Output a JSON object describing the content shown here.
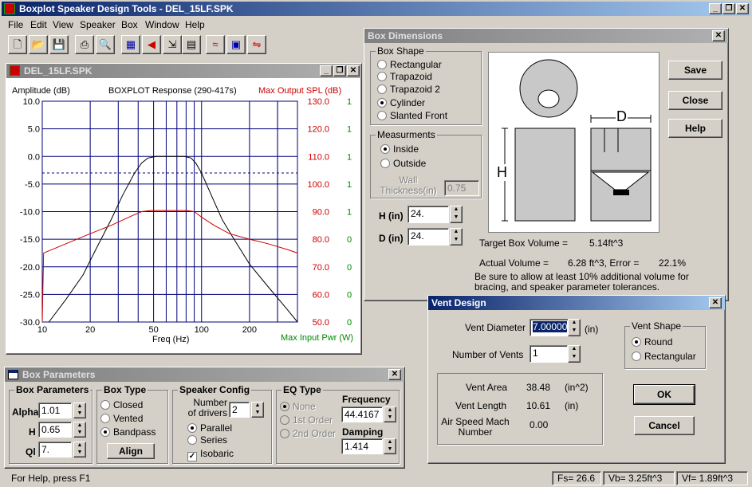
{
  "app": {
    "title": "Boxplot Speaker Design Tools - DEL_15LF.SPK"
  },
  "menu": [
    "File",
    "Edit",
    "View",
    "Speaker",
    "Box",
    "Window",
    "Help"
  ],
  "toolbar_icons": [
    "new-file-icon",
    "open-folder-icon",
    "save-disk-icon",
    "print-icon",
    "print-preview-icon",
    "speaker-params-icon",
    "speaker-cone-icon",
    "export-icon",
    "table-icon",
    "crossover-icon",
    "box-design-icon",
    "filter-icon"
  ],
  "graph": {
    "title": "DEL_15LF.SPK",
    "left_label": "Amplitude (dB)",
    "center_label": "BOXPLOT Response (290-417s)",
    "right_label": "Max Output SPL (dB)",
    "xlabel": "Freq (Hz)",
    "bottom_right_label": "Max Input Pwr (W)"
  },
  "chart_data": {
    "type": "line",
    "title": "BOXPLOT Response (290-417s)",
    "xlabel": "Freq (Hz)",
    "ylabel": "Amplitude (dB)",
    "xscale": "log",
    "xlim": [
      10,
      400
    ],
    "ylim": [
      -30,
      10
    ],
    "grid": true,
    "x_ticks": [
      "10",
      "20",
      "50",
      "100",
      "200"
    ],
    "y_ticks": [
      "10.0",
      "5.0",
      "0.0",
      "-5.0",
      "-10.0",
      "-15.0",
      "-20.0",
      "-25.0",
      "-30.0"
    ],
    "spl_ticks": [
      "130.0",
      "120.0",
      "110.0",
      "100.0",
      "90.0",
      "80.0",
      "70.0",
      "60.0",
      "50.0"
    ],
    "pwr_ticks": [
      "1",
      "1",
      "1",
      "1",
      "1",
      "0",
      "0",
      "0",
      "0"
    ],
    "reference_line_y": -3,
    "series": [
      {
        "color": "#000000",
        "x": [
          11,
          14,
          18,
          22,
          27,
          32,
          38,
          42,
          46,
          52,
          60,
          70,
          78,
          86,
          92,
          100,
          115,
          135,
          160,
          200,
          260,
          340,
          400
        ],
        "values": [
          -30,
          -26,
          -21.5,
          -16.5,
          -11.5,
          -7,
          -3,
          -1.2,
          -0.3,
          0,
          0,
          0,
          0,
          -0.3,
          -1.2,
          -3,
          -7,
          -11.5,
          -15,
          -19.5,
          -23.5,
          -27.5,
          -30
        ]
      },
      {
        "color": "#cc0000",
        "x": [
          10,
          10.2,
          15,
          20,
          27,
          35,
          42,
          48,
          55,
          70,
          80,
          90,
          100,
          120,
          150,
          200,
          260,
          340,
          400
        ],
        "values": [
          -30,
          -17.5,
          -15.5,
          -14,
          -12.5,
          -11,
          -10,
          -9.8,
          -9.8,
          -9.8,
          -9.8,
          -10,
          -11,
          -12.5,
          -14,
          -15,
          -15.8,
          -16.8,
          -17.5
        ]
      }
    ]
  },
  "box_dims": {
    "title": "Box Dimensions",
    "shape_group": "Box Shape",
    "shapes": [
      "Rectangular",
      "Trapazoid",
      "Trapazoid 2",
      "Cylinder",
      "Slanted Front"
    ],
    "selected_shape": 3,
    "meas_group": "Measurments",
    "meas": [
      "Inside",
      "Outside"
    ],
    "wall_label_1": "Wall",
    "wall_label_2": "Thickness(in)",
    "wall_value": "0.75",
    "h_label": "H (in)",
    "h_value": "24.",
    "d_label": "D (in)",
    "d_value": "24.",
    "diagram_h": "H",
    "diagram_d": "D",
    "save": "Save",
    "close": "Close",
    "help": "Help",
    "target_label": "Target Box Volume =",
    "target_value": "5.14ft^3",
    "actual_label": "Actual Volume =",
    "actual_value": "6.28 ft^3, Error =",
    "error_value": "22.1%",
    "note": "Be sure to allow at least 10% additional volume for bracing, and speaker parameter tolerances."
  },
  "vent": {
    "title": "Vent Design",
    "diam_label": "Vent Diameter",
    "diam_value": "7.00000",
    "diam_unit": "(in)",
    "num_label": "Number of Vents",
    "num_value": "1",
    "shape_group": "Vent Shape",
    "shapes": [
      "Round",
      "Rectangular"
    ],
    "area_label": "Vent Area",
    "area_value": "38.48",
    "area_unit": "(in^2)",
    "length_label": "Vent Length",
    "length_value": "10.61",
    "length_unit": "(in)",
    "mach_label_1": "Air Speed Mach",
    "mach_label_2": "Number",
    "mach_value": "0.00",
    "ok": "OK",
    "cancel": "Cancel"
  },
  "box_params": {
    "title": "Box Parameters",
    "group1": "Box Parameters",
    "alpha_label": "Alpha",
    "alpha_value": "1.01",
    "h_label": "H",
    "h_value": "0.65",
    "ql_label": "Ql",
    "ql_value": "7.",
    "type_group": "Box Type",
    "types": [
      "Closed",
      "Vented",
      "Bandpass"
    ],
    "align": "Align",
    "config_group": "Speaker Config",
    "drivers_label_1": "Number",
    "drivers_label_2": "of drivers",
    "drivers_value": "2",
    "configs": [
      "Parallel",
      "Series"
    ],
    "isobaric": "Isobaric",
    "eq_group": "EQ Type",
    "eq": [
      "None",
      "1st Order",
      "2nd Order"
    ],
    "freq_label": "Frequency",
    "freq_value": "44.4167",
    "damp_label": "Damping",
    "damp_value": "1.414"
  },
  "status": {
    "help": "For Help, press F1",
    "fs": "Fs= 26.6",
    "vb": "Vb= 3.25ft^3",
    "vf": "Vf= 1.89ft^3"
  }
}
